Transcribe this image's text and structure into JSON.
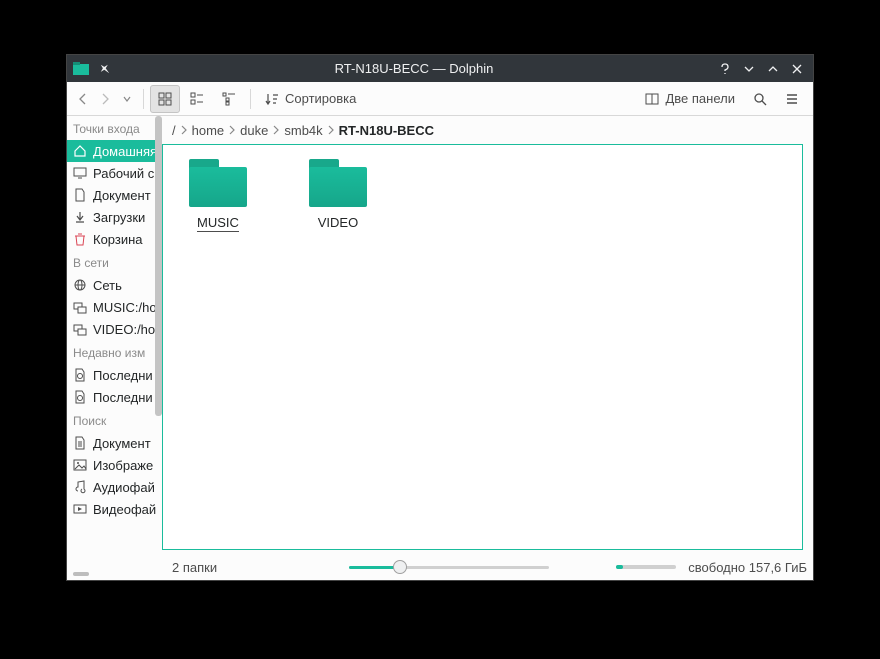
{
  "title": "RT-N18U-BECC — Dolphin",
  "toolbar": {
    "sort_label": "Сортировка",
    "panels_label": "Две панели"
  },
  "breadcrumb": [
    "/",
    "home",
    "duke",
    "smb4k",
    "RT-N18U-BECC"
  ],
  "sidebar": {
    "sections": [
      {
        "title": "Точки входа",
        "items": [
          {
            "icon": "home",
            "label": "Домашняя",
            "selected": true
          },
          {
            "icon": "desktop",
            "label": "Рабочий с"
          },
          {
            "icon": "doc",
            "label": "Документ"
          },
          {
            "icon": "download",
            "label": "Загрузки"
          },
          {
            "icon": "trash",
            "label": "Корзина",
            "red": true
          }
        ]
      },
      {
        "title": "В сети",
        "items": [
          {
            "icon": "globe",
            "label": "Сеть"
          },
          {
            "icon": "netshare",
            "label": "MUSIC:/ho"
          },
          {
            "icon": "netshare",
            "label": "VIDEO:/ho"
          }
        ]
      },
      {
        "title": "Недавно изм",
        "items": [
          {
            "icon": "recent",
            "label": "Последни"
          },
          {
            "icon": "recent",
            "label": "Последни"
          }
        ]
      },
      {
        "title": "Поиск",
        "items": [
          {
            "icon": "doclines",
            "label": "Документ"
          },
          {
            "icon": "image",
            "label": "Изображе"
          },
          {
            "icon": "music",
            "label": "Аудиофай"
          },
          {
            "icon": "video",
            "label": "Видеофай"
          }
        ]
      }
    ]
  },
  "folders": [
    {
      "name": "MUSIC",
      "selected": true
    },
    {
      "name": "VIDEO",
      "selected": false
    }
  ],
  "statusbar": {
    "count": "2 папки",
    "free": "свободно 157,6 ГиБ"
  }
}
